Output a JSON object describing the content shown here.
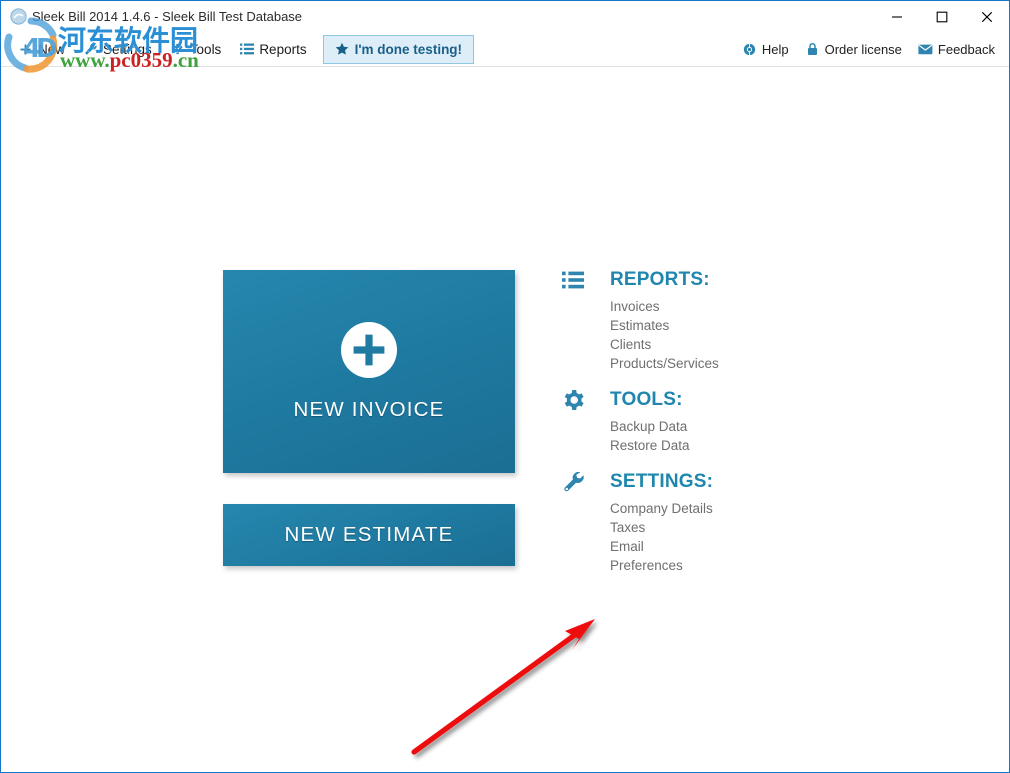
{
  "window": {
    "title": "Sleek Bill 2014 1.4.6 - Sleek Bill Test Database",
    "app_icon": "app-logo-icon",
    "controls": {
      "minimize": "minimize-icon",
      "maximize": "maximize-icon",
      "close": "close-icon"
    },
    "border_color": "#1476c9"
  },
  "menubar": {
    "left_items": [
      {
        "label": "New",
        "icon": "plus-icon"
      },
      {
        "label": "Settings",
        "icon": "wrench-icon"
      },
      {
        "label": "Tools",
        "icon": "gear-icon"
      },
      {
        "label": "Reports",
        "icon": "list-icon"
      },
      {
        "label": "I'm done testing!",
        "icon": "star-icon",
        "highlighted": true
      }
    ],
    "right_items": [
      {
        "label": "Help",
        "icon": "help-icon"
      },
      {
        "label": "Order license",
        "icon": "lock-icon"
      },
      {
        "label": "Feedback",
        "icon": "envelope-icon"
      }
    ]
  },
  "watermark": {
    "logo": "site-logo-icon",
    "chinese_text": "河东软件园",
    "url_green_1": "www.",
    "url_red": "pc0359",
    "url_green_2": ".cn"
  },
  "main": {
    "invoice_tile": {
      "label": "NEW INVOICE",
      "icon": "plus-circle-icon",
      "color": "#1f7ba2"
    },
    "estimate_tile": {
      "label": "NEW ESTIMATE",
      "color": "#1f7ba2"
    },
    "sections": [
      {
        "title": "REPORTS:",
        "icon": "list-icon",
        "links": [
          "Invoices",
          "Estimates",
          "Clients",
          "Products/Services"
        ]
      },
      {
        "title": "TOOLS:",
        "icon": "gear-icon",
        "links": [
          "Backup Data",
          "Restore Data"
        ]
      },
      {
        "title": "SETTINGS:",
        "icon": "wrench-icon",
        "links": [
          "Company Details",
          "Taxes",
          "Email",
          "Preferences"
        ]
      }
    ],
    "heading_color": "#1f87ad",
    "link_color": "#6f6f6f"
  },
  "annotation": {
    "arrow": "red-pointer-arrow",
    "color": "#ee1111",
    "points_to": "Email"
  }
}
